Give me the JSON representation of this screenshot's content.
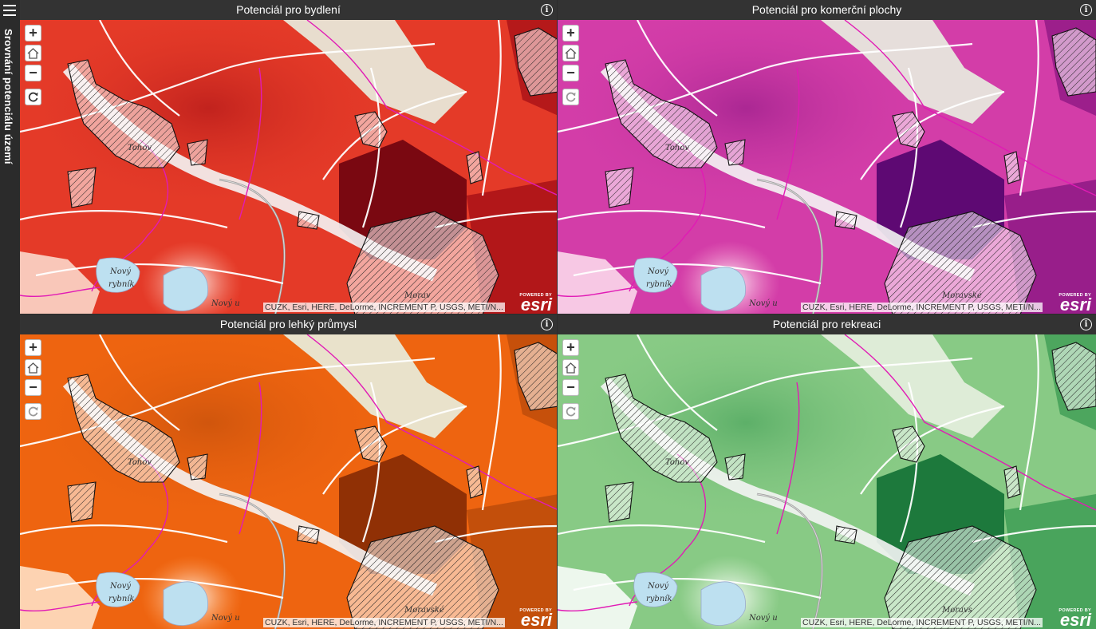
{
  "sidebar": {
    "title": "Srovnání potenciálu území",
    "menu_icon": "hamburger-icon"
  },
  "panels": [
    {
      "title": "Potenciál pro bydlení",
      "scheme": "red",
      "colors": [
        "#fde0d2",
        "#f5836a",
        "#e43a28",
        "#a50f15",
        "#67000d"
      ],
      "labels": {
        "tohov": "Tohov",
        "pond1": "Nový",
        "pond2": "rybník",
        "pond3": "Nový u",
        "town": "Morav"
      }
    },
    {
      "title": "Potenciál pro komerční plochy",
      "scheme": "purple",
      "colors": [
        "#fde0ef",
        "#f59ac8",
        "#d33da8",
        "#8a1682",
        "#49006a"
      ],
      "labels": {
        "tohov": "Tohov",
        "pond1": "Nový",
        "pond2": "rybník",
        "pond3": "Nový u",
        "town": "Moravské"
      }
    },
    {
      "title": "Potenciál pro lehký průmysl",
      "scheme": "orange",
      "colors": [
        "#ffe6cf",
        "#fd9a4f",
        "#ee6410",
        "#b84a0a",
        "#7f2704"
      ],
      "labels": {
        "tohov": "Tohov",
        "pond1": "Nový",
        "pond2": "rybník",
        "pond3": "Nový u",
        "town": "Moravské"
      }
    },
    {
      "title": "Potenciál pro rekreaci",
      "scheme": "green",
      "colors": [
        "#ffffff",
        "#d4eecd",
        "#88ca85",
        "#3a9a51",
        "#0b6b2f"
      ],
      "labels": {
        "tohov": "Tohov",
        "pond1": "Nový",
        "pond2": "rybník",
        "pond3": "Nový u",
        "town": "Moravs"
      }
    }
  ],
  "controls": {
    "zoom_in": "+",
    "zoom_out": "−",
    "info": "i"
  },
  "attribution": "CUZK, Esri, HERE, DeLorme, INCREMENT P, USGS, METI/N...",
  "esri": {
    "powered_by": "POWERED BY",
    "logo": "esri"
  }
}
